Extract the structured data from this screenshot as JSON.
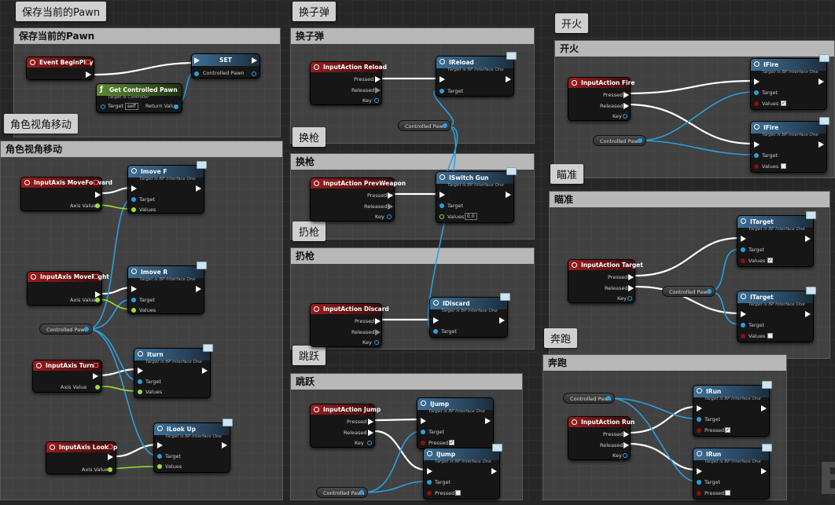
{
  "sections": {
    "save_pawn": "保存当前的Pawn",
    "move": "角色视角移动",
    "reload": "换子弹",
    "switch": "换枪",
    "discard": "扔枪",
    "jump": "跳跃",
    "fire": "开火",
    "aim": "瞄准",
    "run": "奔跑"
  },
  "pins": {
    "pressed": "Pressed",
    "released": "Released",
    "key": "Key",
    "target": "Target",
    "values": "Values",
    "axis_value": "Axis Value",
    "return_value": "Return Value",
    "controlled_pawn": "Controlled Pawn",
    "self": "self",
    "bp_interface": "Target is BP Interface One",
    "target_is_controller": "Target is Controller",
    "float_zero": "0.0"
  },
  "nodes": {
    "event_beginplay": "Event BeginPlay",
    "set": "SET",
    "get_controlled_pawn": "Get Controlled Pawn",
    "move_forward": "InputAxis MoveForward",
    "imove_f": "Imove F",
    "move_right": "InputAxis MoveRight",
    "imove_r": "Imove R",
    "turn": "InputAxis Turn",
    "iturn": "Iturn",
    "lookup": "InputAxis LookUp",
    "ilookup": "ILook Up",
    "reload_action": "InputAction Reload",
    "ireload": "IReload",
    "prevweapon": "InputAction PrevWeapon",
    "iswitch": "ISwitch Gun",
    "discard_action": "InputAction Discard",
    "idiscard": "IDiscard",
    "jump_action": "InputAction Jump",
    "ijump": "IJump",
    "fire_action": "InputAction Fire",
    "ifire": "IFire",
    "target_action": "InputAction Target",
    "itarget": "ITarget",
    "run_action": "InputAction Run",
    "irun": "IRun"
  },
  "corner_glyph": "B"
}
